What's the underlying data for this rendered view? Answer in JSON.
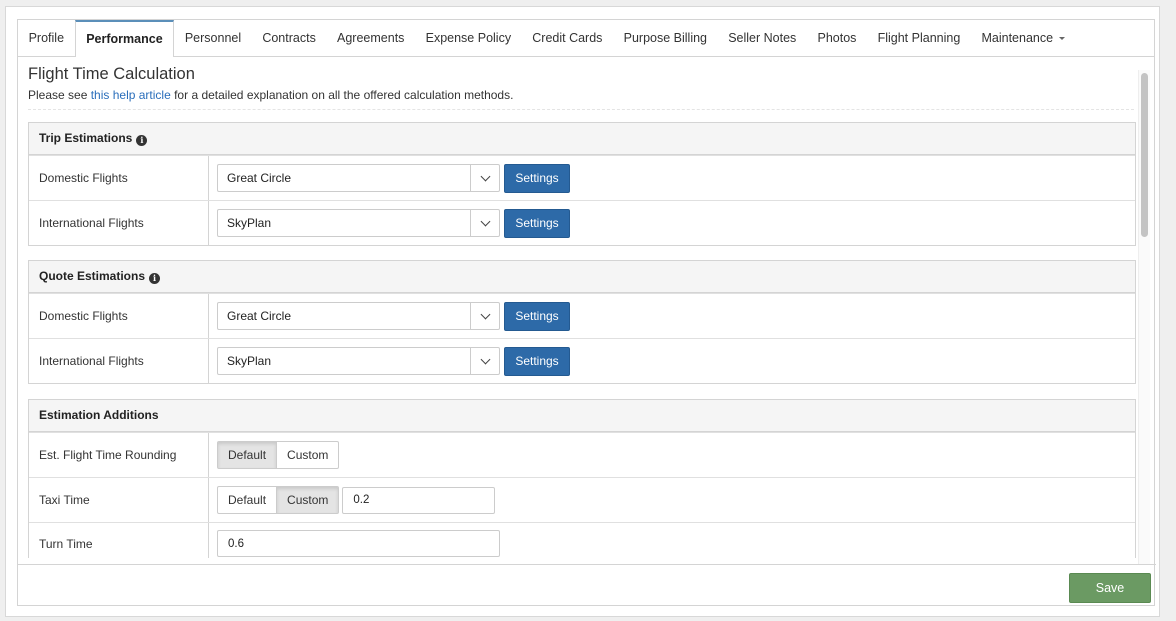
{
  "tabs": [
    {
      "label": "Profile",
      "active": false
    },
    {
      "label": "Performance",
      "active": true
    },
    {
      "label": "Personnel",
      "active": false
    },
    {
      "label": "Contracts",
      "active": false
    },
    {
      "label": "Agreements",
      "active": false
    },
    {
      "label": "Expense Policy",
      "active": false
    },
    {
      "label": "Credit Cards",
      "active": false
    },
    {
      "label": "Purpose Billing",
      "active": false
    },
    {
      "label": "Seller Notes",
      "active": false
    },
    {
      "label": "Photos",
      "active": false
    },
    {
      "label": "Flight Planning",
      "active": false
    },
    {
      "label": "Maintenance",
      "active": false,
      "dropdown": true
    }
  ],
  "page": {
    "title": "Flight Time Calculation",
    "subtitle_before": "Please see ",
    "subtitle_link": "this help article",
    "subtitle_after": " for a detailed explanation on all the offered calculation methods."
  },
  "trip": {
    "heading": "Trip Estimations",
    "rows": [
      {
        "label": "Domestic Flights",
        "value": "Great Circle",
        "button": "Settings"
      },
      {
        "label": "International Flights",
        "value": "SkyPlan",
        "button": "Settings"
      }
    ]
  },
  "quote": {
    "heading": "Quote Estimations",
    "rows": [
      {
        "label": "Domestic Flights",
        "value": "Great Circle",
        "button": "Settings"
      },
      {
        "label": "International Flights",
        "value": "SkyPlan",
        "button": "Settings"
      }
    ]
  },
  "additions": {
    "heading": "Estimation Additions",
    "rounding": {
      "label": "Est. Flight Time Rounding",
      "opt_default": "Default",
      "opt_custom": "Custom",
      "selected": "Default"
    },
    "taxi": {
      "label": "Taxi Time",
      "opt_default": "Default",
      "opt_custom": "Custom",
      "selected": "Custom",
      "value": "0.2"
    },
    "turn": {
      "label": "Turn Time",
      "value": "0.6"
    }
  },
  "footer": {
    "save_label": "Save"
  },
  "colors": {
    "accent": "#2d6aa8",
    "save": "#6b9a63",
    "link": "#2a6ebb"
  },
  "icons": {
    "info": "info-circle-icon",
    "caret": "caret-down-icon",
    "chevron": "chevron-down-icon"
  }
}
